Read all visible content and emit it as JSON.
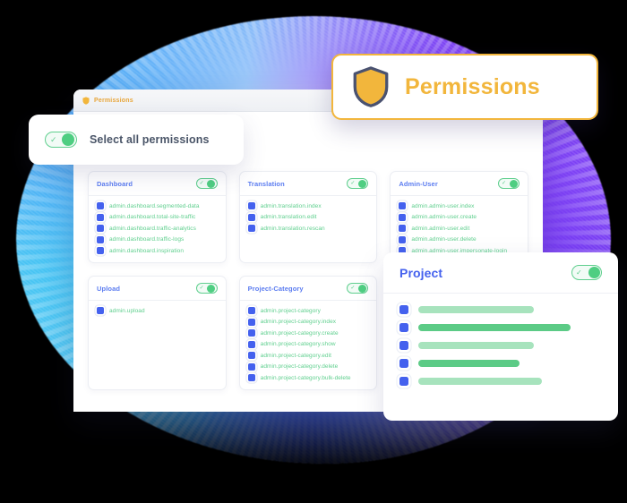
{
  "banner": {
    "title": "Permissions",
    "icon": "shield-icon",
    "accent_color": "#f2b63c"
  },
  "select_all": {
    "label": "Select all permissions",
    "toggle_state": "on",
    "toggle_icon": "check-icon"
  },
  "window": {
    "tab": {
      "label": "Permissions",
      "icon": "shield-icon"
    }
  },
  "cards": [
    {
      "title": "Dashboard",
      "toggle_state": "on",
      "permissions": [
        "admin.dashboard.segmented-data",
        "admin.dashboard.total-site-traffic",
        "admin.dashboard.traffic-analytics",
        "admin.dashboard.traffic-logs",
        "admin.dashboard.inspiration"
      ]
    },
    {
      "title": "Translation",
      "toggle_state": "on",
      "permissions": [
        "admin.translation.index",
        "admin.translation.edit",
        "admin.translation.rescan"
      ]
    },
    {
      "title": "Admin-User",
      "toggle_state": "on",
      "permissions": [
        "admin.admin-user.index",
        "admin.admin-user.create",
        "admin.admin-user.edit",
        "admin.admin-user.delete",
        "admin.admin-user.impersonate-login"
      ]
    },
    {
      "title": "Upload",
      "toggle_state": "on",
      "permissions": [
        "admin.upload"
      ]
    },
    {
      "title": "Project-Category",
      "toggle_state": "on",
      "permissions": [
        "admin.project-category",
        "admin.project-category.index",
        "admin.project-category.create",
        "admin.project-category.show",
        "admin.project-category.edit",
        "admin.project-category.delete",
        "admin.project-category.bulk-delete"
      ]
    }
  ],
  "project_card": {
    "title": "Project",
    "toggle_state": "on",
    "toggle_icon": "check-icon",
    "rows": [
      {
        "width_pct": 57,
        "color": "#a7e3bd"
      },
      {
        "width_pct": 75,
        "color": "#5ccb86"
      },
      {
        "width_pct": 57,
        "color": "#a7e3bd"
      },
      {
        "width_pct": 50,
        "color": "#5ccb86"
      },
      {
        "width_pct": 61,
        "color": "#a7e3bd"
      }
    ]
  },
  "theme": {
    "checkbox_color": "#4461ee",
    "permission_text_color": "#5fcf8e",
    "card_title_color": "#5b7cf0",
    "toggle_color": "#4fce82"
  }
}
